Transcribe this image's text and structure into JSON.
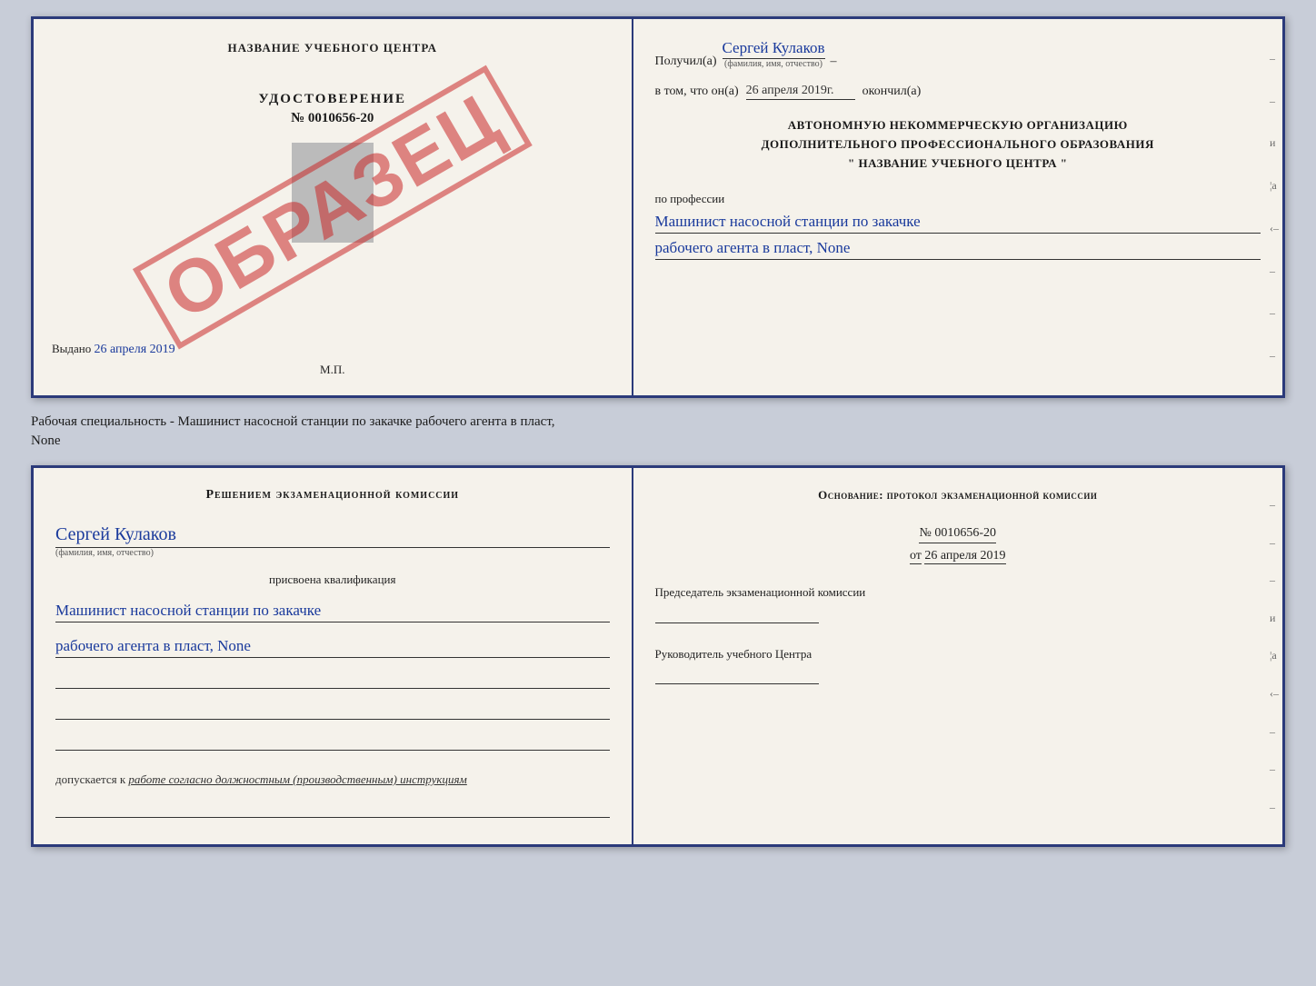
{
  "topDoc": {
    "left": {
      "centerTitle": "НАЗВАНИЕ УЧЕБНОГО ЦЕНТРА",
      "stamp": "ОБРАЗЕЦ",
      "udostoverenie": {
        "title": "УДОСТОВЕРЕНИЕ",
        "number": "№ 0010656-20"
      },
      "vydano": "Выдано",
      "vydanoDate": "26 апреля 2019",
      "mp": "М.П."
    },
    "right": {
      "poluchilLabel": "Получил(a)",
      "poluchilName": "Сергей Кулаков",
      "fioSub": "(фамилия, имя, отчество)",
      "dashAfterName": "–",
      "vtomLabel": "в том, что он(а)",
      "vtomDate": "26 апреля 2019г.",
      "okonchilLabel": "окончил(а)",
      "orgLine1": "АВТОНОМНУЮ НЕКОММЕРЧЕСКУЮ ОРГАНИЗАЦИЮ",
      "orgLine2": "ДОПОЛНИТЕЛЬНОГО ПРОФЕССИОНАЛЬНОГО ОБРАЗОВАНИЯ",
      "orgLine3": "\"  НАЗВАНИЕ УЧЕБНОГО ЦЕНТРА  \"",
      "poProfessii": "по профессии",
      "profession1": "Машинист насосной станции по закачке",
      "profession2": "рабочего агента в пласт, None"
    }
  },
  "betweenLabel": {
    "line1": "Рабочая специальность - Машинист насосной станции по закачке рабочего агента в пласт,",
    "line2": "None"
  },
  "bottomDoc": {
    "left": {
      "title": "Решением  экзаменационной  комиссии",
      "name": "Сергей Кулаков",
      "fioSub": "(фамилия, имя, отчество)",
      "prisvoena": "присвоена квалификация",
      "profession1": "Машинист насосной станции по закачке",
      "profession2": "рабочего агента в пласт, None",
      "dopuskaetsyaLabel": "допускается к",
      "dopuskaetsyaText": "работе согласно должностным (производственным) инструкциям"
    },
    "right": {
      "osnovanieTitle": "Основание: протокол экзаменационной комиссии",
      "protocolNumber": "№ 0010656-20",
      "otLabel": "от",
      "otDate": "26 апреля 2019",
      "predsedatelLabel": "Председатель экзаменационной комиссии",
      "rukovoditelLabel": "Руководитель учебного Центра"
    }
  }
}
